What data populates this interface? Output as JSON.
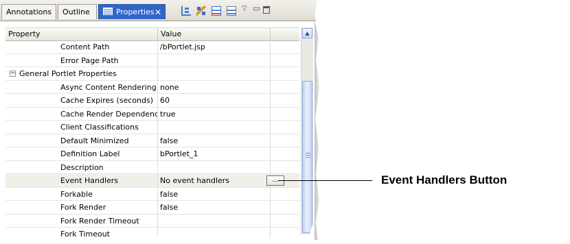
{
  "tabs": [
    {
      "label": "Annotations",
      "active": false
    },
    {
      "label": "Outline",
      "active": false
    },
    {
      "label": "Properties",
      "active": true
    }
  ],
  "view_toolbar": {
    "icons": [
      "tree-view-icon",
      "filter-icon",
      "show-categories-icon",
      "show-advanced-icon",
      "view-menu-icon",
      "minimize-icon",
      "maximize-icon"
    ]
  },
  "table": {
    "columns": [
      "Property",
      "Value"
    ],
    "rows": [
      {
        "property": "Content Path",
        "value": "/bPortlet.jsp",
        "type": "item"
      },
      {
        "property": "Error Page Path",
        "value": "",
        "type": "item"
      },
      {
        "property": "General Portlet Properties",
        "value": "",
        "type": "group",
        "expander": "−"
      },
      {
        "property": "Async Content Rendering",
        "value": "none",
        "type": "item"
      },
      {
        "property": "Cache Expires (seconds)",
        "value": "60",
        "type": "item"
      },
      {
        "property": "Cache Render Dependencies",
        "value": "true",
        "type": "item"
      },
      {
        "property": "Client Classifications",
        "value": "",
        "type": "item"
      },
      {
        "property": "Default Minimized",
        "value": "false",
        "type": "item"
      },
      {
        "property": "Definition Label",
        "value": "bPortlet_1",
        "type": "item"
      },
      {
        "property": "Description",
        "value": "",
        "type": "item"
      },
      {
        "property": "Event Handlers",
        "value": "No event handlers",
        "type": "item",
        "button": "...",
        "selected": true
      },
      {
        "property": "Forkable",
        "value": "false",
        "type": "item"
      },
      {
        "property": "Fork Render",
        "value": "false",
        "type": "item"
      },
      {
        "property": "Fork Render Timeout",
        "value": "",
        "type": "item"
      },
      {
        "property": "Fork Timeout",
        "value": "",
        "type": "item"
      }
    ]
  },
  "scrollbar": {
    "up_arrow": "▲"
  },
  "callout": {
    "label": "Event Handlers Button"
  },
  "colors": {
    "active_tab": "#3166c9",
    "callout_line": "#000000"
  }
}
